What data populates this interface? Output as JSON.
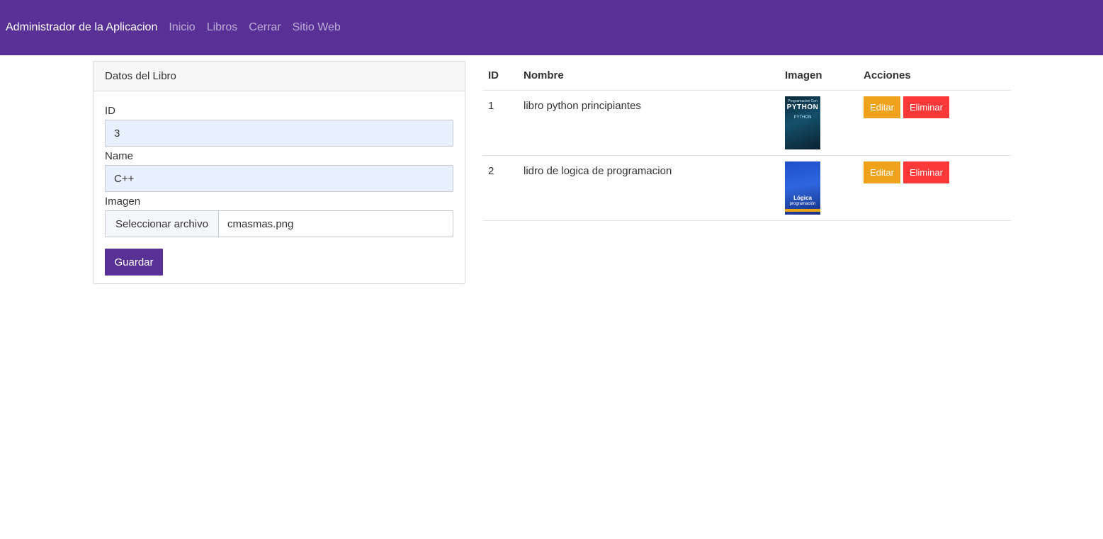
{
  "navbar": {
    "brand": "Administrador de la Aplicacion",
    "links": [
      "Inicio",
      "Libros",
      "Cerrar",
      "Sitio Web"
    ],
    "background": "#593196"
  },
  "form": {
    "header": "Datos del Libro",
    "id_label": "ID",
    "id_value": "3",
    "name_label": "Name",
    "name_value": "C++",
    "image_label": "Imagen",
    "file_button": "Seleccionar archivo",
    "file_name": "cmasmas.png",
    "save_label": "Guardar"
  },
  "table": {
    "columns": [
      "ID",
      "Nombre",
      "Imagen",
      "Acciones"
    ],
    "rows": [
      {
        "id": "1",
        "name": "libro python principiantes",
        "cover": {
          "top": "Programacion Con",
          "title": "PYTHON",
          "bottom": "PYTHON"
        },
        "edit": "Editar",
        "delete": "Eliminar"
      },
      {
        "id": "2",
        "name": "lidro de logica de programacion",
        "cover": {
          "line1": "Lógica",
          "line2": "programación"
        },
        "edit": "Editar",
        "delete": "Eliminar"
      }
    ]
  },
  "colors": {
    "primary": "#593196",
    "warning": "#efa31d",
    "danger": "#fc3939"
  }
}
